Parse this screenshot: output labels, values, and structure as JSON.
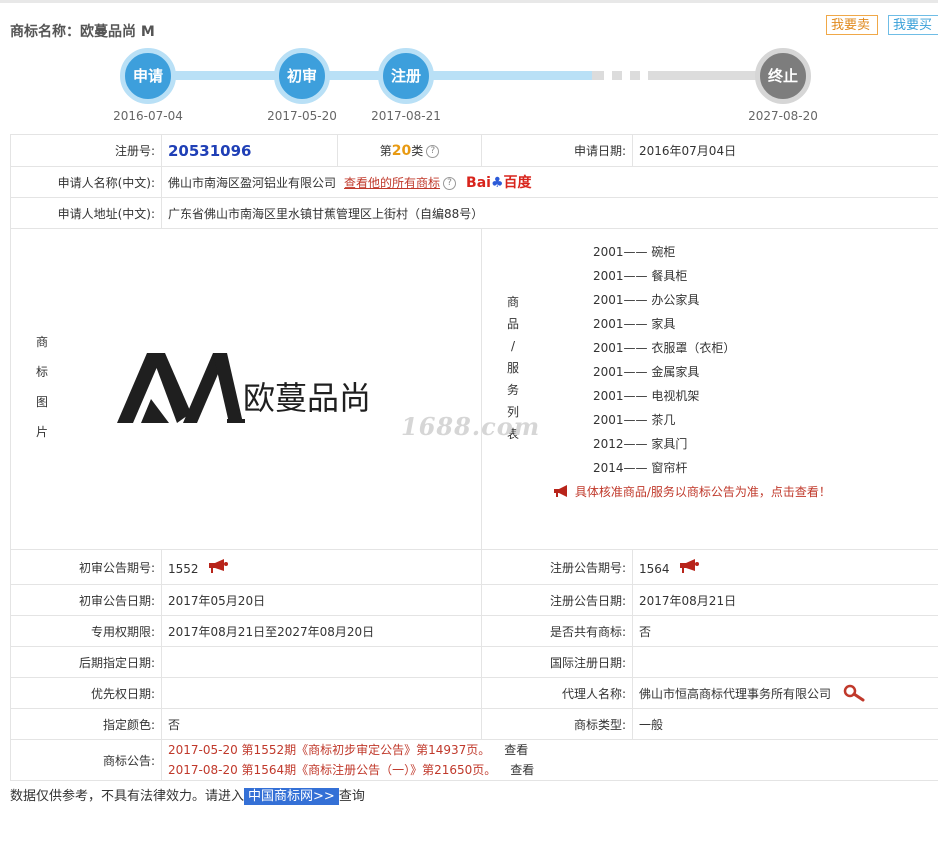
{
  "header": {
    "title": "商标名称：欧蔓品尚 M",
    "sell_label": "我要卖",
    "buy_label": "我要买"
  },
  "timeline": {
    "steps": [
      {
        "label": "申请",
        "date": "2016-07-04"
      },
      {
        "label": "初审",
        "date": "2017-05-20"
      },
      {
        "label": "注册",
        "date": "2017-08-21"
      },
      {
        "label": "终止",
        "date": "2027-08-20"
      }
    ]
  },
  "info": {
    "reg_no_label": "注册号:",
    "reg_no": "20531096",
    "class_prefix": "第",
    "class_num": "20",
    "class_suffix": "类",
    "help_glyph": "?",
    "apply_date_label": "申请日期:",
    "apply_date": "2016年07月04日",
    "applicant_label": "申请人名称(中文):",
    "applicant": "佛山市南海区盈河铝业有限公司",
    "all_marks_link": "查看他的所有商标",
    "baidu_left": "Bai",
    "baidu_paw": "♣",
    "baidu_right": "百度",
    "address_label": "申请人地址(中文):",
    "address": "广东省佛山市南海区里水镇甘蕉管理区上街村（自编88号）",
    "image_label_chars": [
      "商",
      "标",
      "图",
      "片"
    ],
    "logo_text": "欧蔓品尚",
    "goods_label_chars": [
      "商",
      "品",
      "/",
      "服",
      "务",
      "列",
      "表"
    ],
    "goods": [
      "2001—— 碗柜",
      "2001—— 餐具柜",
      "2001—— 办公家具",
      "2001—— 家具",
      "2001—— 衣服罩（衣柜）",
      "2001—— 金属家具",
      "2001—— 电视机架",
      "2001—— 茶几",
      "2012—— 家具门",
      "2014—— 窗帘杆"
    ],
    "goods_note": "具体核准商品/服务以商标公告为准，点击查看！",
    "watermark": "1688.com",
    "prelim_no_label": "初审公告期号:",
    "prelim_no": "1552",
    "reg_pub_no_label": "注册公告期号:",
    "reg_pub_no": "1564",
    "prelim_date_label": "初审公告日期:",
    "prelim_date": "2017年05月20日",
    "reg_pub_date_label": "注册公告日期:",
    "reg_pub_date": "2017年08月21日",
    "exclusive_label": "专用权期限:",
    "exclusive": "2017年08月21日至2027年08月20日",
    "shared_label": "是否共有商标:",
    "shared": "否",
    "later_label": "后期指定日期:",
    "later": "",
    "intl_label": "国际注册日期:",
    "intl": "",
    "priority_label": "优先权日期:",
    "priority": "",
    "agent_label": "代理人名称:",
    "agent": "佛山市恒高商标代理事务所有限公司",
    "color_label": "指定颜色:",
    "color": "否",
    "type_label": "商标类型:",
    "type": "一般",
    "notice_label": "商标公告:",
    "notices": [
      {
        "text": "2017-05-20 第1552期《商标初步审定公告》第14937页。",
        "action": "查看"
      },
      {
        "text": "2017-08-20 第1564期《商标注册公告（一）》第21650页。",
        "action": "查看"
      }
    ]
  },
  "footer": {
    "text_before": "数据仅供参考，不具有法律效力。请进入",
    "link": "中国商标网>>",
    "text_after": "查询"
  },
  "colors": {
    "accent_blue": "#3d9fdc",
    "timeline_track": "#b9e0f6",
    "end_grey": "#7d7d7d",
    "link_red": "#c0392b",
    "reg_no_blue": "#1f3fb6"
  }
}
